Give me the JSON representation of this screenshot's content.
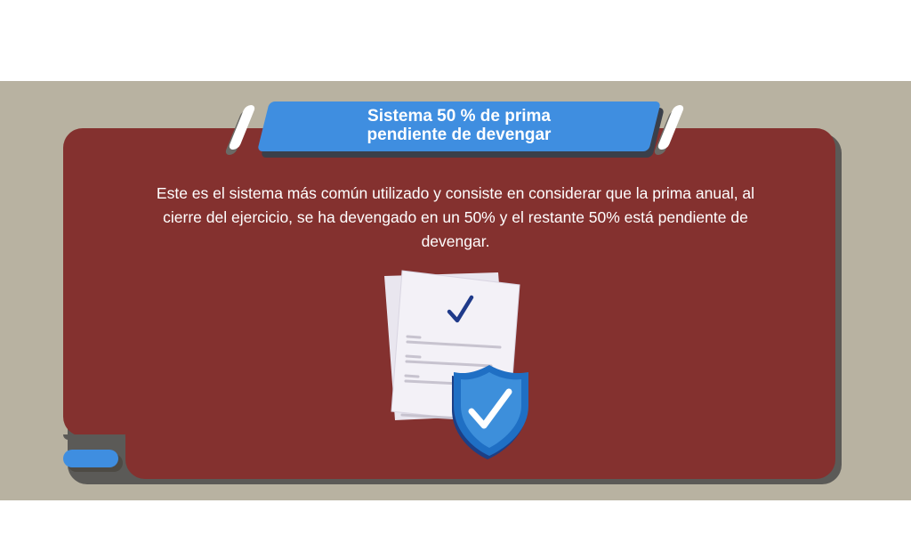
{
  "banner": {
    "title": "Sistema  50 % de prima\npendiente de devengar"
  },
  "content": {
    "description": "Este es el sistema más común utilizado y consiste en considerar que la prima anual, al cierre del ejercicio, se ha devengado en un 50% y el restante 50% está pendiente de devengar."
  },
  "icons": {
    "illustration": "document-with-shield-check-icon",
    "document_check": "check-icon",
    "shield_check": "shield-check-icon"
  },
  "colors": {
    "card": "#84312f",
    "band": "#b8b2a1",
    "accent_blue": "#3f8ee0",
    "shield_blue": "#1f6fc4",
    "check_navy": "#1f3a8a"
  }
}
